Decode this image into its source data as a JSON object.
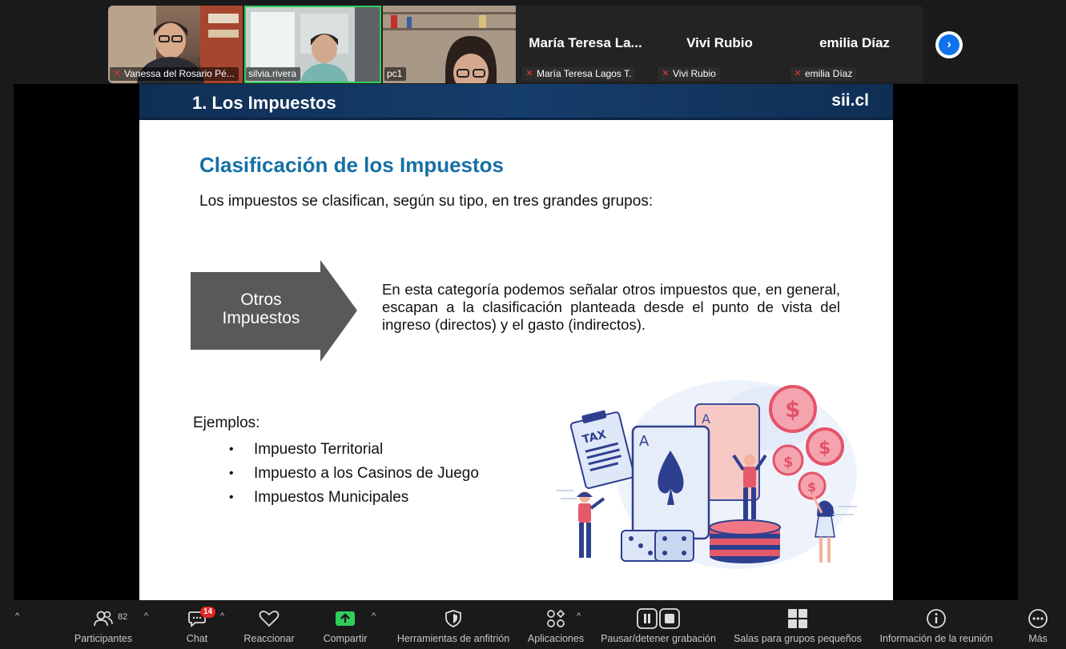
{
  "participants_strip": {
    "video_tiles": [
      {
        "name": "Vanessa del Rosario Pé..."
      },
      {
        "name": "silvia.rivera"
      },
      {
        "name": "pc1"
      }
    ],
    "name_tiles": [
      {
        "display": "María  Teresa  La...",
        "label": "María Teresa Lagos T."
      },
      {
        "display": "Vivi Rubio",
        "label": "Vivi Rubio"
      },
      {
        "display": "emilia Díaz",
        "label": "emilia Díaz"
      }
    ]
  },
  "slide": {
    "header_title": "1. Los Impuestos",
    "header_logo": "sii.cl",
    "title": "Clasificación de los Impuestos",
    "subtitle": "Los impuestos se clasifican, según su tipo, en tres grandes grupos:",
    "arrow_label_line1": "Otros",
    "arrow_label_line2": "Impuestos",
    "description": "En esta categoría podemos señalar otros impuestos que, en general, escapan a la clasificación planteada desde el punto de vista del ingreso (directos) y el gasto (indirectos).",
    "examples_label": "Ejemplos:",
    "examples": [
      "Impuesto Territorial",
      "Impuesto a los Casinos de Juego",
      "Impuestos Municipales"
    ],
    "illustration_text": "TAX",
    "card_letter": "A"
  },
  "toolbar": {
    "participants_label": "Participantes",
    "participants_count": "82",
    "chat_label": "Chat",
    "chat_badge": "14",
    "react_label": "Reaccionar",
    "share_label": "Compartir",
    "host_tools_label": "Herramientas de anfitrión",
    "apps_label": "Aplicaciones",
    "record_label": "Pausar/detener grabación",
    "breakout_label": "Salas para grupos pequeños",
    "info_label": "Información de la reunión",
    "more_label": "Más"
  },
  "colors": {
    "accent_blue": "#1570a6",
    "share_green": "#2fce5b",
    "badge_red": "#e02828",
    "zoom_blue": "#0e72ed"
  }
}
